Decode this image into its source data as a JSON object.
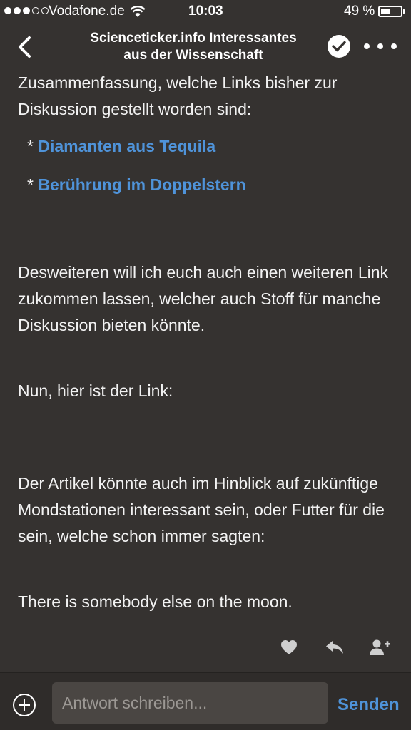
{
  "status_bar": {
    "carrier": "Vodafone.de",
    "time": "10:03",
    "battery_percent": "49 %",
    "battery_level": 0.49
  },
  "nav": {
    "title_line1": "Scienceticker.info Interessantes",
    "title_line2": "aus der Wissenschaft"
  },
  "post": {
    "intro": "Zusammenfassung, welche Links bisher zur Diskussion gestellt worden sind:",
    "links": [
      {
        "bullet": "* ",
        "label": "Diamanten aus Tequila"
      },
      {
        "bullet": "* ",
        "label": "Berührung im Doppelstern"
      }
    ],
    "paragraph_further": "Desweiteren will ich euch auch einen weiteren Link zukommen lassen, welcher auch Stoff für manche Diskussion bieten könnte.",
    "paragraph_nun": "Nun, hier ist der Link:",
    "paragraph_artikel": "Der Artikel könnte auch im Hinblick auf zukünftige Mondstationen interessant sein, oder Futter für die sein, welche schon immer sagten:",
    "paragraph_moon": "There is somebody else on the moon."
  },
  "actions": {
    "like_icon": "heart-icon",
    "reply_icon": "reply-icon",
    "follow_icon": "add-user-icon"
  },
  "reply_bar": {
    "placeholder": "Antwort schreiben...",
    "send_label": "Senden"
  },
  "colors": {
    "background": "#353230",
    "link": "#4f93d9"
  }
}
